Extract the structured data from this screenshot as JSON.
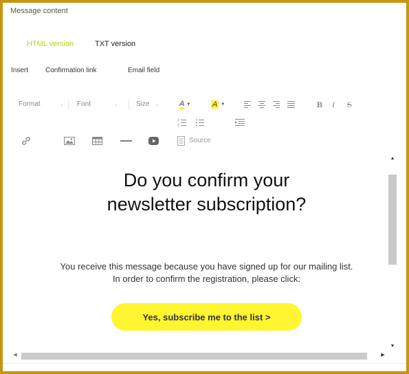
{
  "editor": {
    "section_title": "Message content",
    "tabs": [
      {
        "label": "HTML version",
        "active": true
      },
      {
        "label": "TXT version",
        "active": false
      }
    ],
    "insert": {
      "label": "Insert",
      "items": [
        "Confirmation link",
        "Email field"
      ]
    },
    "toolbar": {
      "format": "Format",
      "font": "Font",
      "size": "Size",
      "text_color_icon": "text-color-icon",
      "bg_color_icon": "background-color-icon",
      "bold": "B",
      "italic": "I",
      "strike": "S",
      "source": "Source",
      "highlight_color": "#fff531",
      "text_color_underline": "#fff531"
    },
    "content": {
      "headline_line1": "Do you confirm your",
      "headline_line2": "newsletter subscription?",
      "body_line1": "You receive this message because you have signed up for our mailing list.",
      "body_line2": "In order to confirm the registration, please click:",
      "cta_label": "Yes, subscribe me to the list >",
      "cta_color": "#fff531"
    },
    "colors": {
      "frame": "#c8950f",
      "active_tab": "#b6d40f"
    }
  }
}
